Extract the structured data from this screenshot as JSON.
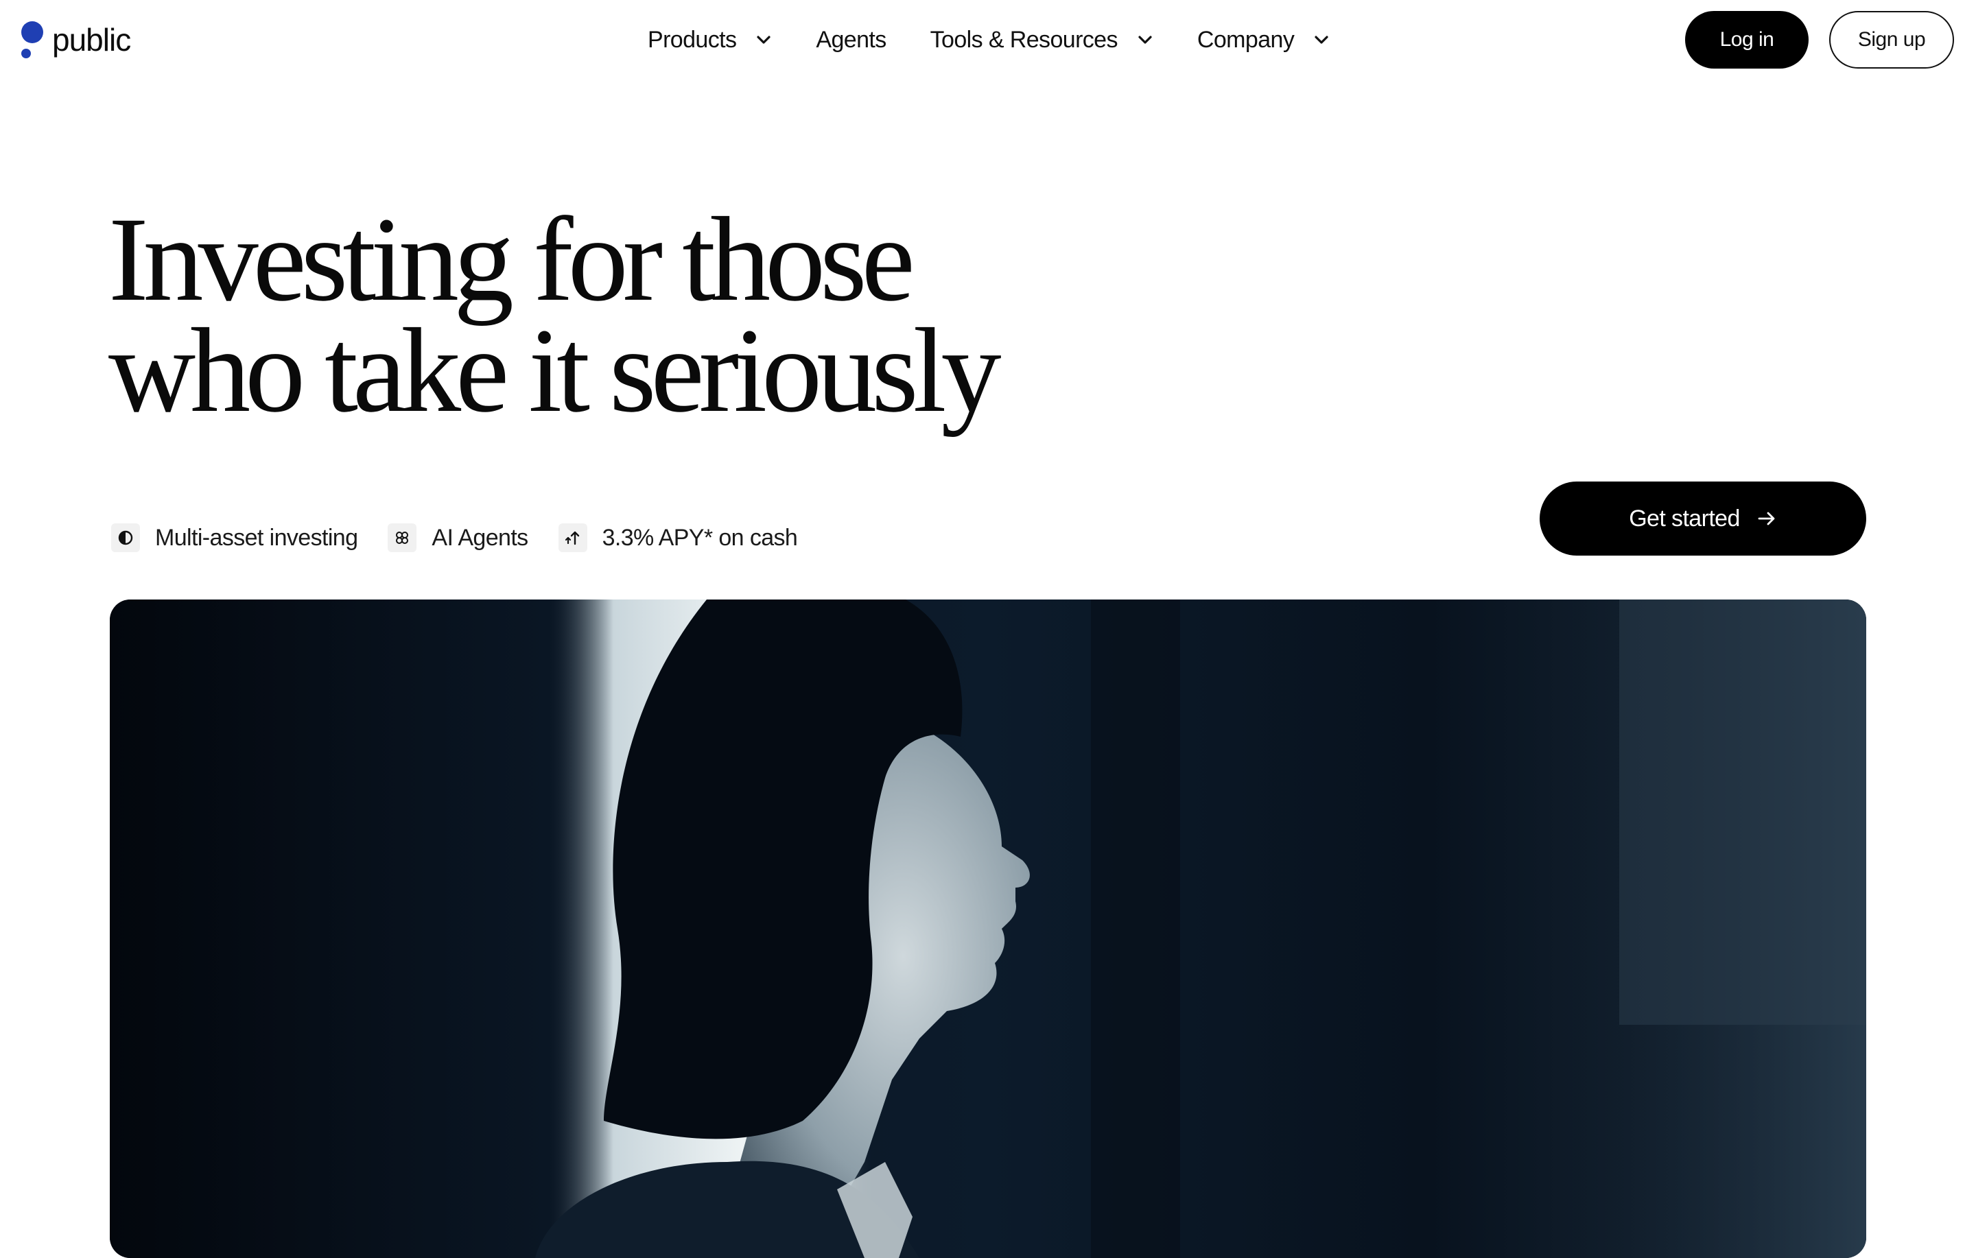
{
  "brand": {
    "name": "public",
    "accent": "#1f3fb3"
  },
  "nav": {
    "items": [
      {
        "label": "Products",
        "has_dropdown": true
      },
      {
        "label": "Agents",
        "has_dropdown": false
      },
      {
        "label": "Tools & Resources",
        "has_dropdown": true
      },
      {
        "label": "Company",
        "has_dropdown": true
      }
    ],
    "login_label": "Log in",
    "signup_label": "Sign up"
  },
  "hero": {
    "title_line1": "Investing for those",
    "title_line2": "who take it seriously",
    "features": [
      {
        "icon": "half-circle-icon",
        "label": "Multi-asset investing"
      },
      {
        "icon": "agents-knot-icon",
        "label": "AI Agents"
      },
      {
        "icon": "arrow-up-icon",
        "label": "3.3% APY* on cash"
      }
    ],
    "cta_label": "Get started",
    "media": {
      "description_icon": "video-still-woman-profile",
      "tone_color": "#0a1a2a"
    }
  }
}
